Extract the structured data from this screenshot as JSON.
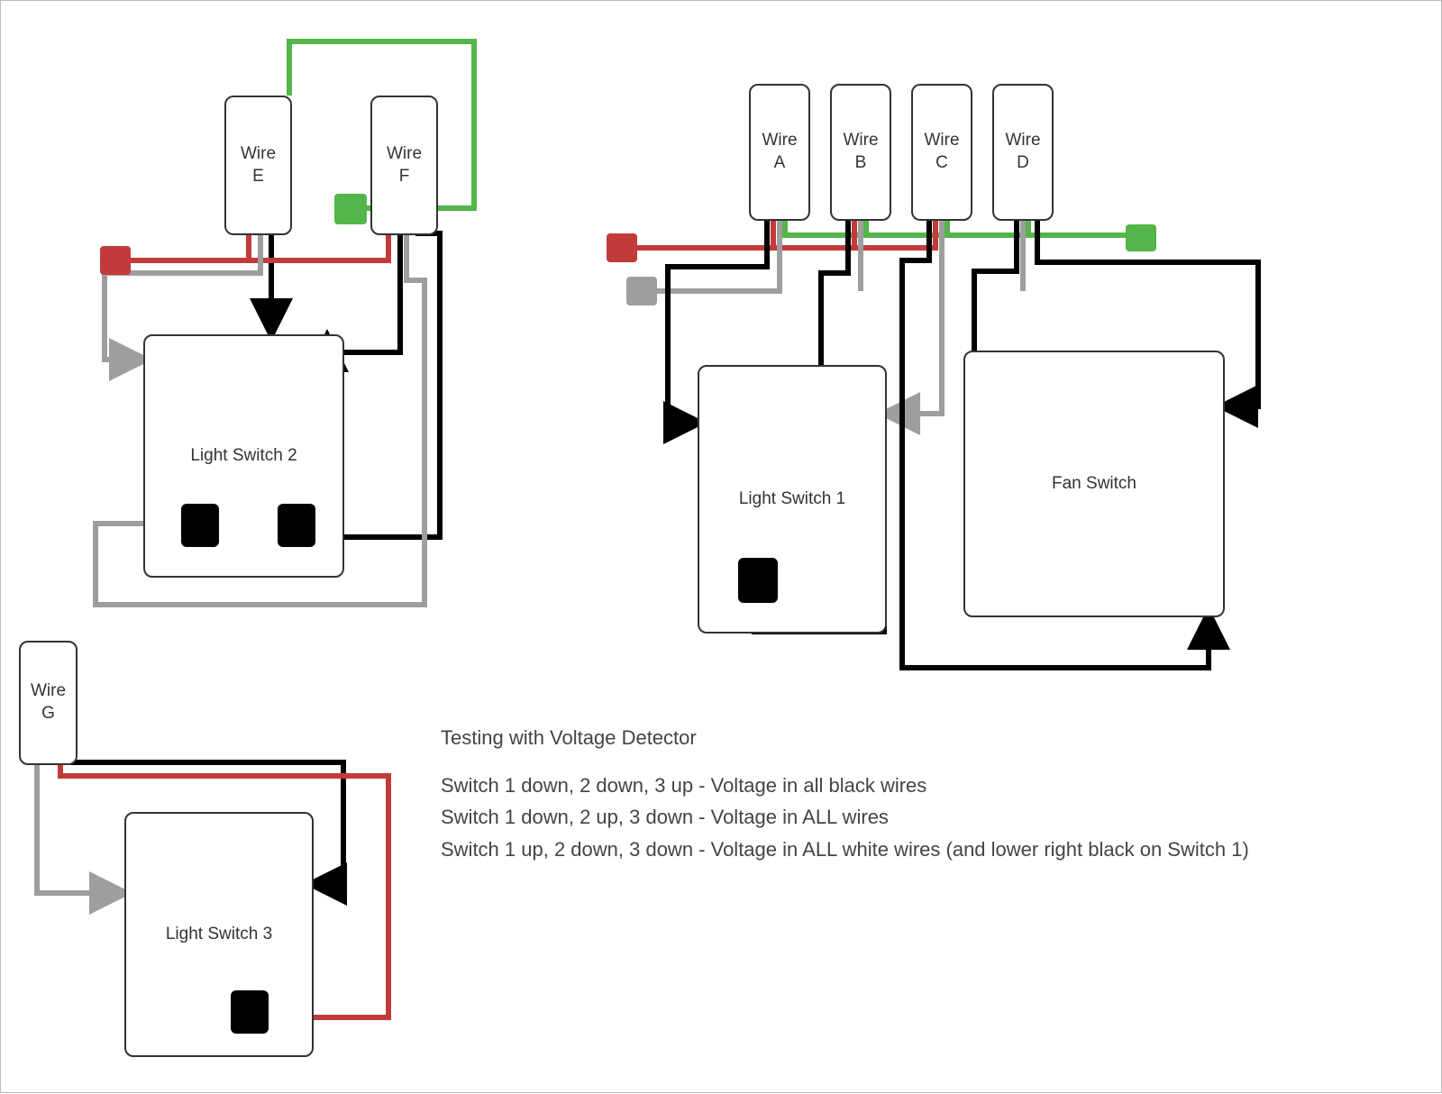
{
  "wires": {
    "e": "Wire\nE",
    "f": "Wire\nF",
    "a": "Wire\nA",
    "b": "Wire\nB",
    "c": "Wire\nC",
    "d": "Wire\nD",
    "g": "Wire\nG"
  },
  "switches": {
    "ls1": "Light Switch 1",
    "ls2": "Light Switch 2",
    "ls3": "Light Switch 3",
    "fan": "Fan Switch"
  },
  "notes": {
    "title": "Testing with Voltage Detector",
    "line1": "Switch 1 down, 2 down, 3 up - Voltage in all black wires",
    "line2": "Switch 1 down, 2 up, 3 down - Voltage in ALL wires",
    "line3": "Switch 1 up, 2 down, 3 down - Voltage in ALL white wires (and lower right black on Switch 1)"
  },
  "colors": {
    "black": "#000000",
    "red": "#c23b3b",
    "green": "#54b54a",
    "gray": "#9e9e9e",
    "outline": "#333333"
  }
}
